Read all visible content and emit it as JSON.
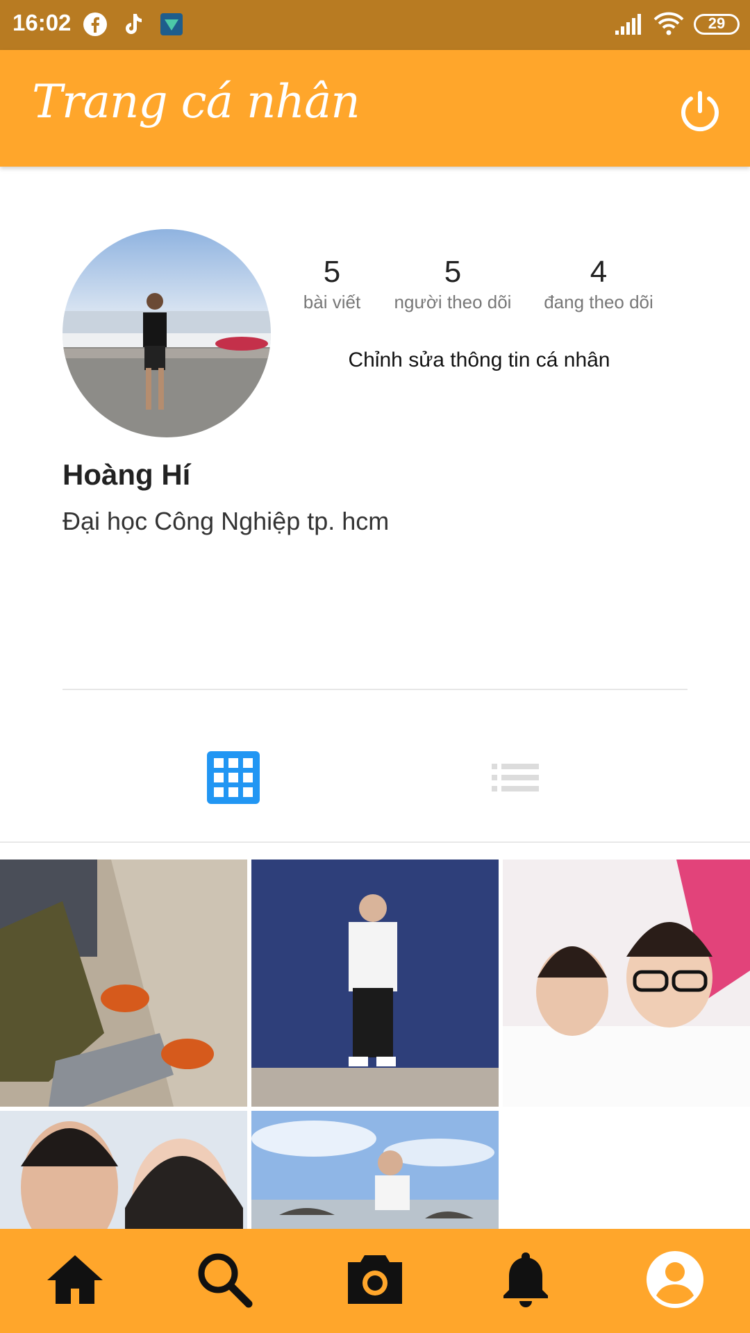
{
  "status_bar": {
    "time": "16:02",
    "battery": "29"
  },
  "app_bar": {
    "title": "Trang cá nhân"
  },
  "profile": {
    "name": "Hoàng Hí",
    "bio": "Đại học Công Nghiệp tp. hcm",
    "edit_label": "Chỉnh sửa thông tin cá nhân",
    "stats": [
      {
        "count": "5",
        "label": "bài viết"
      },
      {
        "count": "5",
        "label": "người theo dõi"
      },
      {
        "count": "4",
        "label": "đang theo dõi"
      }
    ]
  },
  "view_toggle": {
    "active": "grid",
    "accent": "#2196f3",
    "inactive": "#dcdcdc"
  },
  "bottom_nav": {
    "items": [
      "home-icon",
      "search-icon",
      "camera-icon",
      "bell-icon",
      "account-icon"
    ]
  },
  "colors": {
    "status_bar": "#b87b22",
    "app_bar": "#ffa62b"
  }
}
